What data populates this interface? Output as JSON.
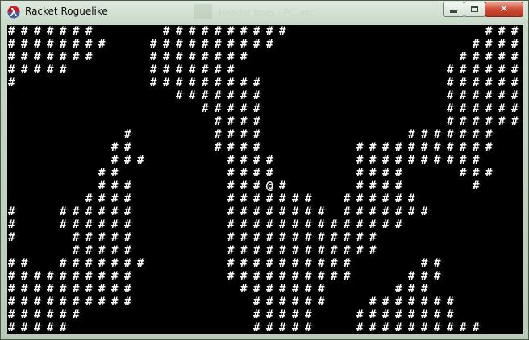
{
  "window": {
    "title": "Racket Roguelike",
    "background_ghost_text": "Header goes · PC, etc.",
    "buttons": {
      "minimize": "minimize",
      "maximize": "maximize",
      "close": "close"
    },
    "colors": {
      "frame": "#c9d9c9",
      "close_button": "#c9472f",
      "viewport": "#000000",
      "glyph": "#ffffff"
    },
    "icon": "racket-lambda-icon"
  },
  "game": {
    "wall_glyph": "#",
    "player_glyph": "@",
    "player": {
      "row": 12,
      "col": 20
    },
    "map": [
      "#######     ##########               ####",
      "########   ##########               #####",
      "#######    ########                #####",
      "#####      #######                #######",
      "#          #########              #######",
      "             #######              #######",
      "               #####              #######",
      "                ####              #######",
      "         #      ####           #######",
      "        ##      ####       ###########",
      "        ###      ####      ##########",
      "       ##        ####      ####    ###",
      "       ###       #####     ####     #",
      "      ####       #######  ######",
      "#   ######       ######## #######",
      "#   ######       ##############",
      "#    #####       ############",
      "     #####       ############",
      "##  #######      ##########     ##",
      "##########       ##########    ###",
      "##########        #######     ###",
      "##########         ######   #######",
      "######             #####   ########",
      "#####              #####   ##########"
    ]
  }
}
